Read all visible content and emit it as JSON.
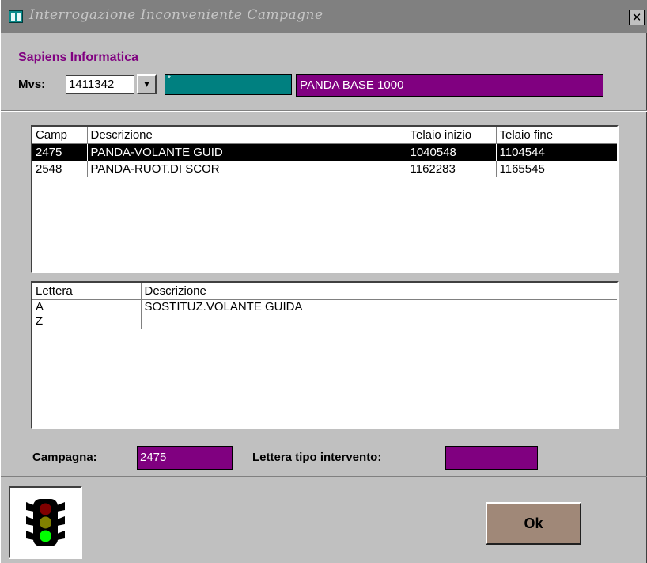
{
  "window": {
    "title": "Interrogazione Inconveniente Campagne",
    "close_glyph": "✕"
  },
  "company": "Sapiens Informatica",
  "mvs": {
    "label": "Mvs:",
    "value": "1411342",
    "dropdown_glyph": "▾",
    "status_mark": "*",
    "model": "PANDA BASE 1000"
  },
  "campaigns": {
    "columns": [
      "Camp",
      "Descrizione",
      "Telaio inizio",
      "Telaio fine"
    ],
    "rows": [
      {
        "camp": "2475",
        "descrizione": "PANDA-VOLANTE GUID",
        "telaio_inizio": "1040548",
        "telaio_fine": "1104544",
        "selected": true
      },
      {
        "camp": "2548",
        "descrizione": "PANDA-RUOT.DI SCOR",
        "telaio_inizio": "1162283",
        "telaio_fine": "1165545",
        "selected": false
      }
    ]
  },
  "interventions": {
    "columns": [
      "Lettera",
      "Descrizione"
    ],
    "rows": [
      {
        "lettera": "A",
        "descrizione": "SOSTITUZ.VOLANTE GUIDA"
      },
      {
        "lettera": "Z",
        "descrizione": ""
      }
    ]
  },
  "footer": {
    "campagna_label": "Campagna:",
    "campagna_value": "2475",
    "lettera_label": "Lettera tipo intervento:",
    "lettera_value": ""
  },
  "buttons": {
    "ok_label": "Ok",
    "traffic_light_icon": "traffic-light-icon"
  },
  "colors": {
    "accent_purple": "#800080",
    "teal": "#008080",
    "ok_button": "#a08878",
    "titlebar": "#808080"
  }
}
